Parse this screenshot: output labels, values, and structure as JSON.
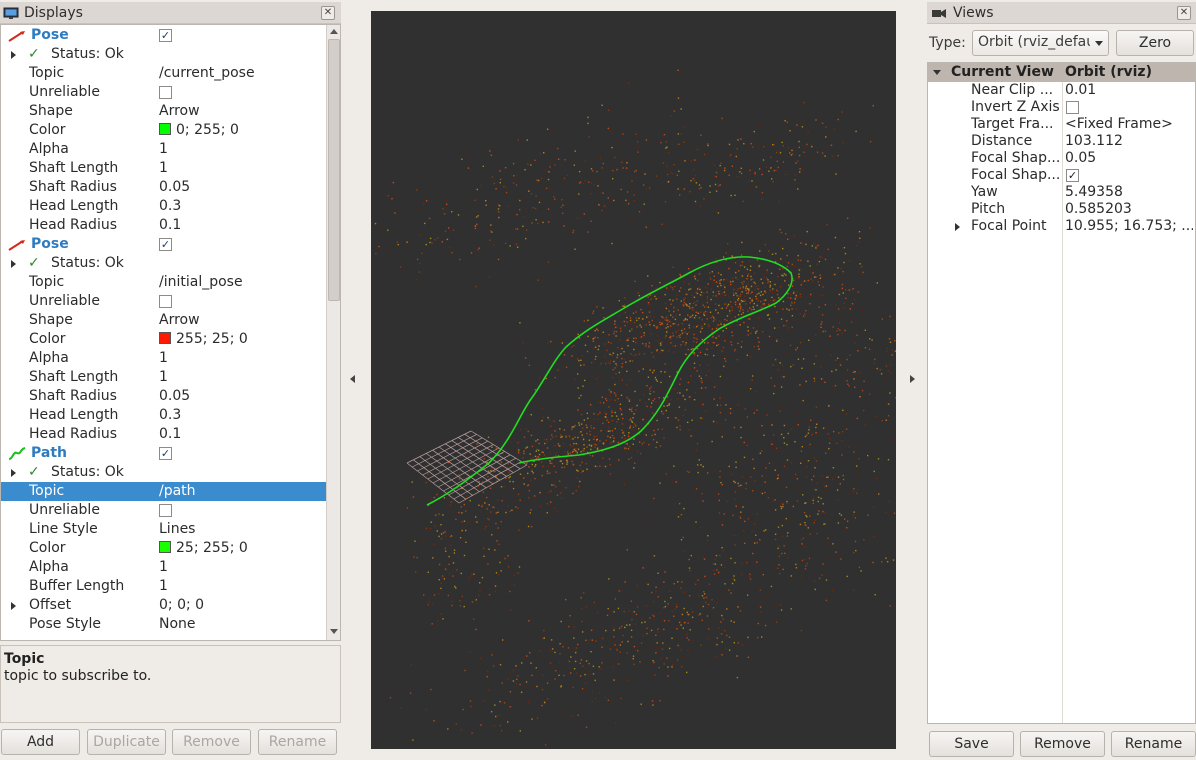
{
  "displays": {
    "title": "Displays",
    "close_glyph": "✕",
    "rows": [
      {
        "label": "Pose",
        "value": "",
        "kind": "display",
        "icon": "pose",
        "checked": true
      },
      {
        "label": "Status: Ok",
        "value": "",
        "kind": "status",
        "expand": true
      },
      {
        "label": "Topic",
        "value": "/current_pose"
      },
      {
        "label": "Unreliable",
        "value": "",
        "kind": "check",
        "checked": false
      },
      {
        "label": "Shape",
        "value": "Arrow"
      },
      {
        "label": "Color",
        "value": "0; 255; 0",
        "swatch": "#00ff00"
      },
      {
        "label": "Alpha",
        "value": "1"
      },
      {
        "label": "Shaft Length",
        "value": "1"
      },
      {
        "label": "Shaft Radius",
        "value": "0.05"
      },
      {
        "label": "Head Length",
        "value": "0.3"
      },
      {
        "label": "Head Radius",
        "value": "0.1"
      },
      {
        "label": "Pose",
        "value": "",
        "kind": "display",
        "icon": "pose",
        "checked": true
      },
      {
        "label": "Status: Ok",
        "value": "",
        "kind": "status",
        "expand": true
      },
      {
        "label": "Topic",
        "value": "/initial_pose"
      },
      {
        "label": "Unreliable",
        "value": "",
        "kind": "check",
        "checked": false
      },
      {
        "label": "Shape",
        "value": "Arrow"
      },
      {
        "label": "Color",
        "value": "255; 25; 0",
        "swatch": "#ff1900"
      },
      {
        "label": "Alpha",
        "value": "1"
      },
      {
        "label": "Shaft Length",
        "value": "1"
      },
      {
        "label": "Shaft Radius",
        "value": "0.05"
      },
      {
        "label": "Head Length",
        "value": "0.3"
      },
      {
        "label": "Head Radius",
        "value": "0.1"
      },
      {
        "label": "Path",
        "value": "",
        "kind": "display",
        "icon": "path",
        "checked": true
      },
      {
        "label": "Status: Ok",
        "value": "",
        "kind": "status",
        "expand": true
      },
      {
        "label": "Topic",
        "value": "/path",
        "selected": true
      },
      {
        "label": "Unreliable",
        "value": "",
        "kind": "check",
        "checked": false
      },
      {
        "label": "Line Style",
        "value": "Lines"
      },
      {
        "label": "Color",
        "value": "25; 255; 0",
        "swatch": "#19ff00"
      },
      {
        "label": "Alpha",
        "value": "1"
      },
      {
        "label": "Buffer Length",
        "value": "1"
      },
      {
        "label": "Offset",
        "value": "0; 0; 0",
        "expand": true
      },
      {
        "label": "Pose Style",
        "value": "None"
      }
    ],
    "help_title": "Topic",
    "help_text": "topic to subscribe to.",
    "buttons": {
      "add": "Add",
      "duplicate": "Duplicate",
      "remove": "Remove",
      "rename": "Rename"
    }
  },
  "views": {
    "title": "Views",
    "close_glyph": "✕",
    "type_label": "Type:",
    "type_value": "Orbit (rviz_defau",
    "zero_label": "Zero",
    "header_label": "Current View",
    "header_value": "Orbit (rviz)",
    "props": [
      {
        "label": "Near Clip ...",
        "value": "0.01"
      },
      {
        "label": "Invert Z Axis",
        "value": "",
        "kind": "check",
        "checked": false
      },
      {
        "label": "Target Fra...",
        "value": "<Fixed Frame>"
      },
      {
        "label": "Distance",
        "value": "103.112"
      },
      {
        "label": "Focal Shap...",
        "value": "0.05"
      },
      {
        "label": "Focal Shap...",
        "value": "",
        "kind": "check",
        "checked": true
      },
      {
        "label": "Yaw",
        "value": "5.49358"
      },
      {
        "label": "Pitch",
        "value": "0.585203"
      },
      {
        "label": "Focal Point",
        "value": "10.955; 16.753; ...",
        "expand": true
      }
    ],
    "buttons": {
      "save": "Save",
      "remove": "Remove",
      "rename": "Rename"
    }
  },
  "viewport": {
    "background": "#303030",
    "path_color": "#22dd22",
    "grid_color": "#b8a0a0"
  }
}
